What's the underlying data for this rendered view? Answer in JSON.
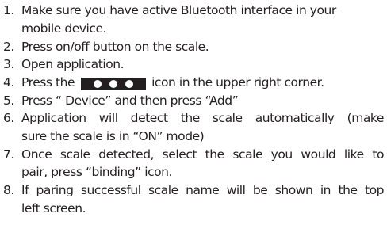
{
  "instructions": [
    {
      "number": "1.",
      "lines": [
        "Make sure you have active Bluetooth interface in your",
        "mobile device."
      ]
    },
    {
      "number": "2.",
      "lines": [
        "Press on/off button on the scale."
      ]
    },
    {
      "number": "3.",
      "lines": [
        "Open application."
      ]
    },
    {
      "number": "4.",
      "before_icon": "Press the",
      "icon": "three-dots-menu-icon",
      "after_icon": "icon in the upper right corner."
    },
    {
      "number": "5.",
      "lines": [
        "Press “ Device” and then press “Add”"
      ]
    },
    {
      "number": "6.",
      "lines": [
        "Application will detect the scale automatically (make",
        "sure the scale is in “ON” mode)"
      ]
    },
    {
      "number": "7.",
      "lines": [
        "Once scale detected, select the scale you would like to",
        "pair, press “binding” icon."
      ]
    },
    {
      "number": "8.",
      "lines": [
        "If paring successful scale name will be shown in the top",
        "left screen."
      ]
    }
  ]
}
